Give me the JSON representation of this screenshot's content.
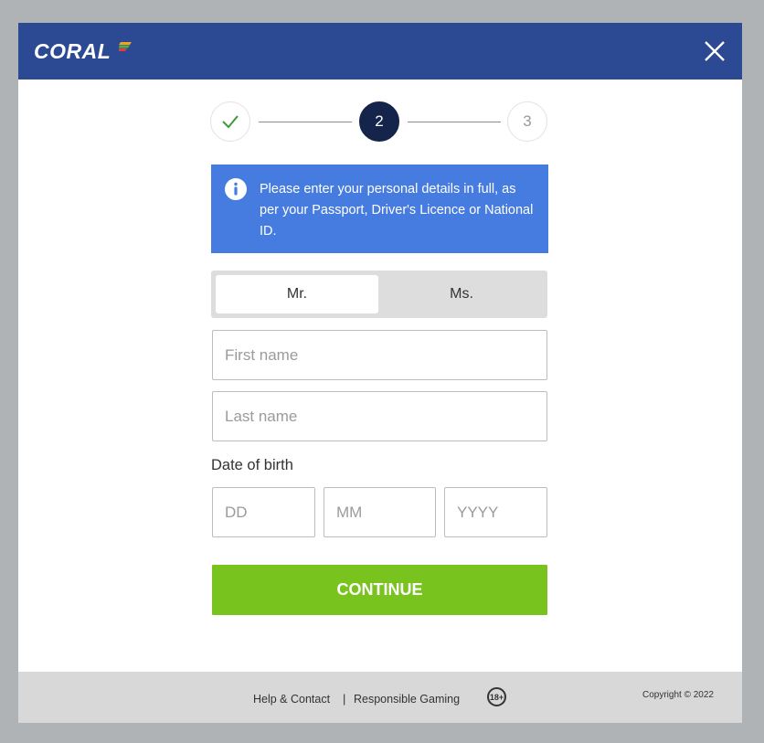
{
  "header": {
    "logo_text": "CORAL",
    "close_icon": "close-icon"
  },
  "stepper": {
    "step1_icon": "check-icon",
    "step2": "2",
    "step3": "3"
  },
  "info": {
    "icon": "info-icon",
    "text": "Please enter your personal details in full, as per your Passport, Driver's Licence or National ID."
  },
  "title_options": {
    "mr": "Mr.",
    "ms": "Ms.",
    "selected": "Mr."
  },
  "first_name": {
    "placeholder": "First name",
    "value": ""
  },
  "last_name": {
    "placeholder": "Last name",
    "value": ""
  },
  "dob": {
    "label": "Date of birth",
    "day_placeholder": "DD",
    "month_placeholder": "MM",
    "year_placeholder": "YYYY"
  },
  "continue_label": "CONTINUE",
  "footer": {
    "help": "Help & Contact",
    "separator": "|",
    "responsible": "Responsible Gaming",
    "age_badge": "18+",
    "copyright": "Copyright © 2022"
  },
  "colors": {
    "header": "#2b4a93",
    "info": "#467be0",
    "continue": "#78c31e",
    "active_step": "#14244a",
    "check": "#3a9a3a"
  }
}
